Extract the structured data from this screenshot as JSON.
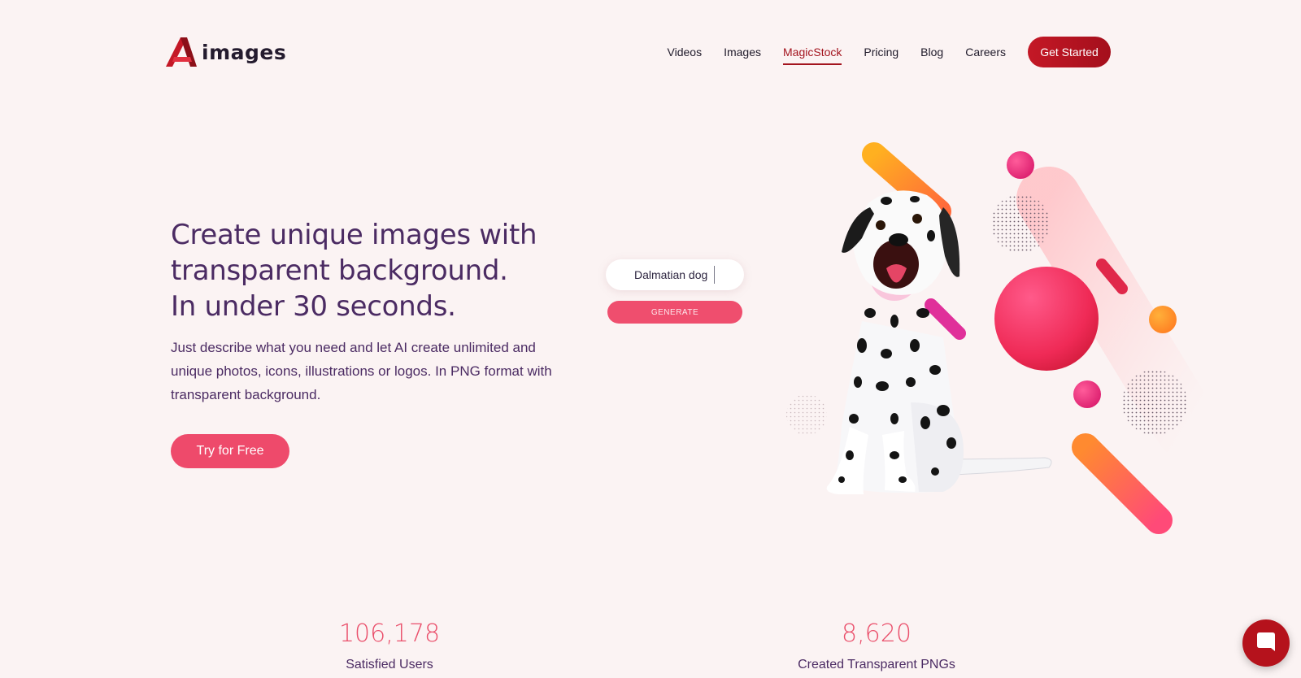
{
  "header": {
    "logo_text": "images",
    "nav": [
      {
        "label": "Videos"
      },
      {
        "label": "Images"
      },
      {
        "label": "MagicStock",
        "active": true
      },
      {
        "label": "Pricing"
      },
      {
        "label": "Blog"
      },
      {
        "label": "Careers"
      }
    ],
    "cta_label": "Get Started"
  },
  "hero": {
    "headline_lines": [
      "Create unique images with",
      "transparent background.",
      "In under 30 seconds."
    ],
    "description": "Just describe what you need and let AI create unlimited and unique photos, icons, illustrations or logos. In PNG format with transparent background.",
    "try_label": "Try for Free"
  },
  "prompt_widget": {
    "value": "Dalmatian dog",
    "button_label": "GENERATE"
  },
  "stats": [
    {
      "value": "106,178",
      "label": "Satisfied Users"
    },
    {
      "value": "8,620",
      "label": "Created Transparent PNGs"
    }
  ],
  "colors": {
    "brand_red": "#b5121c",
    "accent_pink": "#ee4a6b",
    "headline_purple": "#4b2b63",
    "background": "#fbf3f3"
  },
  "icons": {
    "logo": "logo-a-icon",
    "chat": "chat-bubble-icon"
  }
}
